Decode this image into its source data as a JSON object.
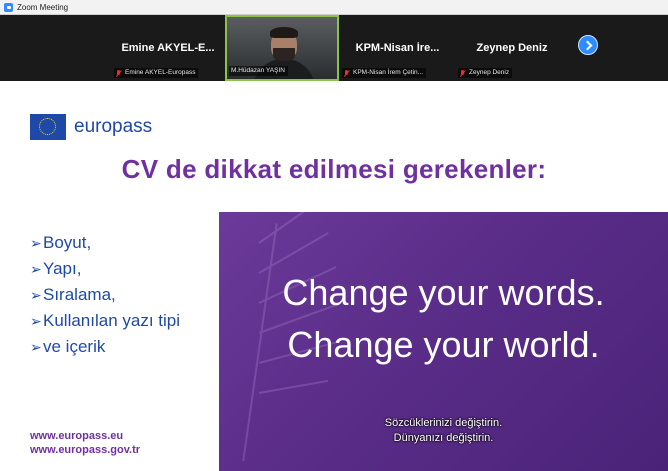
{
  "window": {
    "title": "Zoom Meeting"
  },
  "participants": [
    {
      "display_name": "Emine  AKYEL-E...",
      "label": "Emine AKYEL-Europass",
      "muted": true,
      "video": false
    },
    {
      "display_name": "",
      "label": "M.Hüdazan YAŞIN",
      "muted": false,
      "video": true
    },
    {
      "display_name": "KPM-Nisan  İre...",
      "label": "KPM-Nisan İrem Çetin...",
      "muted": true,
      "video": false
    },
    {
      "display_name": "Zeynep Deniz",
      "label": "Zeynep Deniz",
      "muted": true,
      "video": false
    }
  ],
  "next_button": {
    "icon": "chevron-right-icon"
  },
  "slide": {
    "brand": "europass",
    "title": "CV de dikkat edilmesi gerekenler:",
    "bullets": [
      "Boyut,",
      "Yapı,",
      "Sıralama,",
      "Kullanılan yazı tipi",
      "ve içerik"
    ],
    "bullet_marker": "➢",
    "quote_lines": [
      "Change your words.",
      "Change your world."
    ],
    "subtitles": [
      "Sözcüklerinizi değiştirin.",
      "Dünyanızı değiştirin."
    ],
    "links": [
      "www.europass.eu",
      "www.europass.gov.tr"
    ]
  },
  "colors": {
    "accent_purple": "#7030a0",
    "europass_blue": "#1f49a8",
    "zoom_blue": "#2d8cff",
    "active_speaker": "#8bc34a"
  }
}
